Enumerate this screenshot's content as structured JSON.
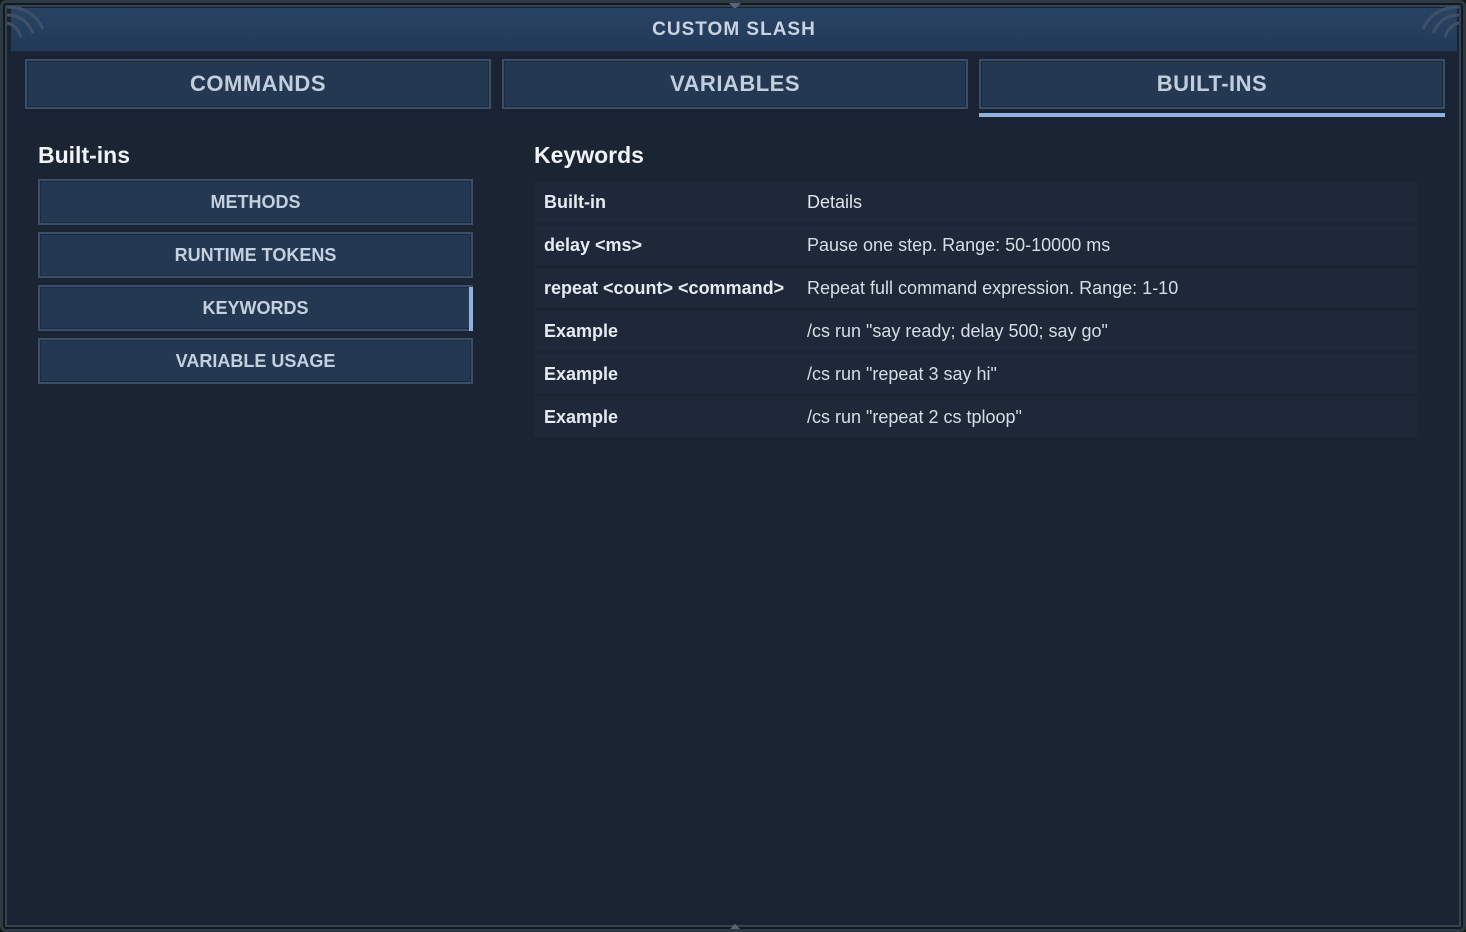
{
  "window": {
    "title": "CUSTOM SLASH"
  },
  "tabs": [
    {
      "label": "COMMANDS",
      "active": false
    },
    {
      "label": "VARIABLES",
      "active": false
    },
    {
      "label": "BUILT-INS",
      "active": true
    }
  ],
  "sidebar": {
    "title": "Built-ins",
    "items": [
      {
        "label": "METHODS",
        "active": false
      },
      {
        "label": "RUNTIME TOKENS",
        "active": false
      },
      {
        "label": "KEYWORDS",
        "active": true
      },
      {
        "label": "VARIABLE USAGE",
        "active": false
      }
    ]
  },
  "main": {
    "title": "Keywords",
    "table": {
      "headers": [
        "Built-in",
        "Details"
      ],
      "rows": [
        [
          "delay <ms>",
          "Pause one step. Range: 50-10000 ms"
        ],
        [
          "repeat <count> <command>",
          "Repeat full command expression. Range: 1-10"
        ],
        [
          "Example",
          "/cs run \"say ready; delay 500; say go\""
        ],
        [
          "Example",
          "/cs run \"repeat 3 say hi\""
        ],
        [
          "Example",
          "/cs run \"repeat 2 cs tploop\""
        ]
      ]
    }
  },
  "colors": {
    "accent": "#8fb1de",
    "button_bg": "#253852",
    "panel_bg": "#1a2432",
    "titlebar_bg": "#223a58"
  }
}
